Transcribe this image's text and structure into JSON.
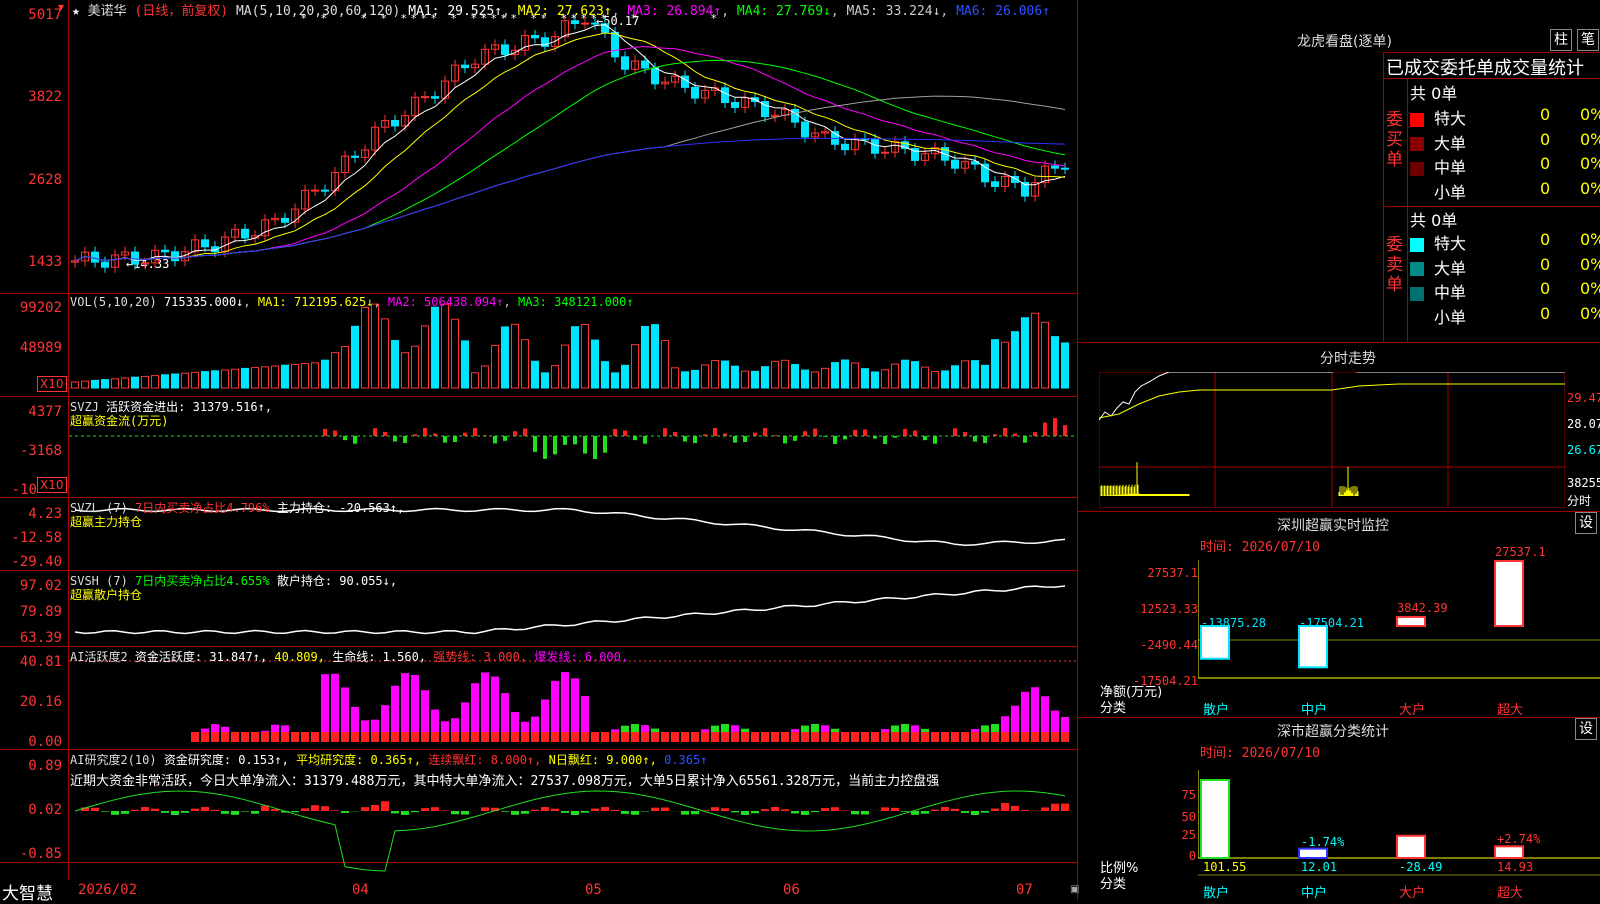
{
  "colors": {
    "up": "#ff3333",
    "down": "#00e5ff",
    "ma1": "#ffffff",
    "ma2": "#ffff00",
    "ma3": "#ff00ff",
    "ma4": "#00ff00",
    "ma5": "#a0a0a0",
    "ma6": "#3030ff",
    "label_red": "#ff3333",
    "label_yellow": "#ffff00"
  },
  "main_chart": {
    "stock_name": "美诺华",
    "period": "(日线，前复权)",
    "ma_label": "MA(5,10,20,30,60,120)",
    "ma1": "MA1: 29.525↑",
    "ma2": "MA2: 27.623↑",
    "ma3": "MA3: 26.894↑",
    "ma4": "MA4: 27.769↓",
    "ma5": "MA5: 33.224↓",
    "ma6": "MA6: 26.006↑",
    "y_labels": [
      "5017",
      "3822",
      "2628",
      "1433"
    ],
    "high_mark": "50.17",
    "low_mark": "14.33"
  },
  "vol_panel": {
    "title": "VOL(5,10,20)",
    "value": "715335.000↓",
    "ma1": "MA1: 712195.625↓",
    "ma2": "MA2: 506438.094↑",
    "ma3": "MA3: 348121.000↑",
    "y_labels": [
      "99202",
      "48989"
    ],
    "x10": "X10"
  },
  "svzj_panel": {
    "title": "SVZJ",
    "text": "活跃资金进出: 31379.516↑,",
    "subtitle": "超赢资金流(万元)",
    "y_labels": [
      "4377",
      "-3168",
      "-10"
    ],
    "x10": "X10"
  },
  "svzl_panel": {
    "title": "SVZL  (7)",
    "ratio": "7日内买卖净占比4.796%",
    "hold": "主力持仓: -20.563↑,",
    "subtitle": "超赢主力持仓",
    "y_labels": [
      "4.23",
      "-12.58",
      "-29.40"
    ]
  },
  "svsh_panel": {
    "title": "SVSH  (7)",
    "ratio": "7日内买卖净占比4.655%",
    "hold": "散户持仓: 90.055↓,",
    "subtitle": "超赢散户持仓",
    "y_labels": [
      "97.02",
      "79.89",
      "63.39"
    ]
  },
  "ai_active_panel": {
    "title": "AI活跃度2",
    "text1": "资金活跃度: 31.847↑,",
    "text2": "40.809,",
    "text3": "生命线: 1.560,",
    "text4": "强势线: 3.000,",
    "text5": "爆发线: 6.000,",
    "y_labels": [
      "40.81",
      "20.16",
      "0.00"
    ]
  },
  "ai_research_panel": {
    "title": "AI研究度2(10)",
    "text1": "资金研究度: 0.153↑,",
    "text2": "平均研究度: 0.365↑,",
    "text3": "连续飘红: 8.000↑,",
    "text4": "N日飘红: 9.000↑,",
    "text5": "0.365↑",
    "comment": "近期大资金非常活跃，今日大单净流入：31379.488万元，其中特大单净流入：27537.098万元，大单5日累计净入65561.328万元，当前主力控盘强",
    "y_labels": [
      "0.89",
      "0.02",
      "-0.85"
    ]
  },
  "x_axis": {
    "brand": "大智慧",
    "dates": [
      "2026/02",
      "04",
      "05",
      "06",
      "07"
    ]
  },
  "right_panel": {
    "dragon_title": "龙虎看盘(逐单)",
    "tab_bar": "柱",
    "tab_pen": "笔",
    "order_title": "已成交委托单成交量统计",
    "buy_label": "委买单",
    "sell_label": "委卖单",
    "buy_total": "共 0单",
    "sell_total": "共 0单",
    "buy_rows": [
      {
        "name": "特大",
        "count": "0",
        "pct": "0%",
        "color": "#ff0000"
      },
      {
        "name": "大单",
        "count": "0",
        "pct": "0%",
        "color": "#8b0000"
      },
      {
        "name": "中单",
        "count": "0",
        "pct": "0%",
        "color": "#6b0000"
      },
      {
        "name": "小单",
        "count": "0",
        "pct": "0%",
        "color": ""
      }
    ],
    "sell_rows": [
      {
        "name": "特大",
        "count": "0",
        "pct": "0%",
        "color": "#00ffff"
      },
      {
        "name": "大单",
        "count": "0",
        "pct": "0%",
        "color": "#008b8b"
      },
      {
        "name": "中单",
        "count": "0",
        "pct": "0%",
        "color": "#007070"
      },
      {
        "name": "小单",
        "count": "0",
        "pct": "0%",
        "color": ""
      }
    ],
    "intraday_title": "分时走势",
    "intraday_prices": [
      "29.47",
      "28.07",
      "26.67"
    ],
    "intraday_vol": "38255",
    "intraday_vol_unit": "分时",
    "sz_monitor_title": "深圳超赢实时监控",
    "sz_monitor_btn": "设",
    "sz_monitor_time": "时间: 2026/07/10",
    "sz_y_labels": [
      "27537.1",
      "12523.33",
      "-2490.44",
      "-17504.21"
    ],
    "sz_y_unit": "净额(万元)",
    "sz_x_unit": "分类",
    "sz_bars": [
      {
        "cat": "散户",
        "value": "-13875.28"
      },
      {
        "cat": "中户",
        "value": "-17504.21"
      },
      {
        "cat": "大户",
        "value": "3842.39"
      },
      {
        "cat": "超大",
        "value": "27537.1"
      }
    ],
    "class_title": "深市超赢分类统计",
    "class_btn": "设",
    "class_time": "时间: 2026/07/10",
    "class_y_labels": [
      "75",
      "50",
      "25",
      "0"
    ],
    "class_y_unit": "比例%",
    "class_x_unit": "分类",
    "class_bars": [
      {
        "cat": "散户",
        "value": "101.55",
        "pct": ""
      },
      {
        "cat": "中户",
        "value": "12.01",
        "pct": "-1.74%"
      },
      {
        "cat": "大户",
        "value": "-28.49",
        "pct": ""
      },
      {
        "cat": "超大",
        "value": "14.93",
        "pct": "+2.74%"
      }
    ]
  }
}
